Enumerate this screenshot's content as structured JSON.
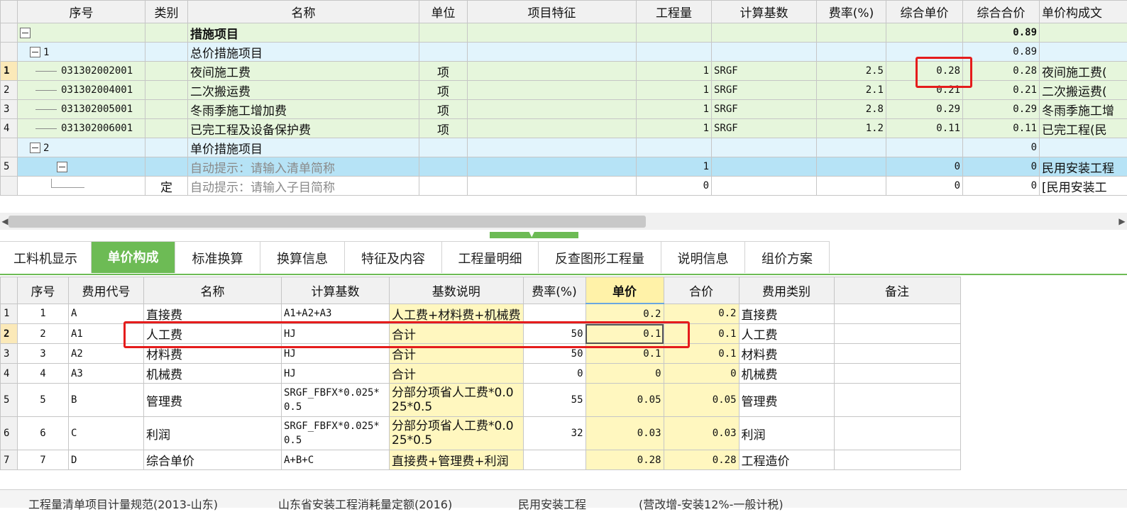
{
  "top_grid": {
    "headers": [
      "序号",
      "类别",
      "名称",
      "单位",
      "项目特征",
      "工程量",
      "计算基数",
      "费率(%)",
      "综合单价",
      "综合合价",
      "单价构成文"
    ],
    "group": {
      "name": "措施项目",
      "total": "0.89"
    },
    "subgroup1": {
      "code": "1",
      "name": "总价措施项目",
      "total": "0.89"
    },
    "rows": [
      {
        "num": "1",
        "code": "031302002001",
        "name": "夜间施工费",
        "unit": "项",
        "qty": "1",
        "base": "SRGF",
        "rate": "2.5",
        "price": "0.28",
        "total": "0.28",
        "comp": "夜间施工费("
      },
      {
        "num": "2",
        "code": "031302004001",
        "name": "二次搬运费",
        "unit": "项",
        "qty": "1",
        "base": "SRGF",
        "rate": "2.1",
        "price": "0.21",
        "total": "0.21",
        "comp": "二次搬运费("
      },
      {
        "num": "3",
        "code": "031302005001",
        "name": "冬雨季施工增加费",
        "unit": "项",
        "qty": "1",
        "base": "SRGF",
        "rate": "2.8",
        "price": "0.29",
        "total": "0.29",
        "comp": "冬雨季施工增"
      },
      {
        "num": "4",
        "code": "031302006001",
        "name": "已完工程及设备保护费",
        "unit": "项",
        "qty": "1",
        "base": "SRGF",
        "rate": "1.2",
        "price": "0.11",
        "total": "0.11",
        "comp": "已完工程(民"
      }
    ],
    "subgroup2": {
      "code": "2",
      "name": "单价措施项目",
      "total": "0"
    },
    "row5": {
      "num": "5",
      "name": "自动提示：请输入清单简称",
      "qty": "1",
      "price": "0",
      "total": "0",
      "comp": "民用安装工程"
    },
    "row6": {
      "type": "定",
      "name": "自动提示：请输入子目简称",
      "qty": "0",
      "price": "0",
      "total": "0",
      "comp": "[民用安装工"
    }
  },
  "tabs": [
    "工料机显示",
    "单价构成",
    "标准换算",
    "换算信息",
    "特征及内容",
    "工程量明细",
    "反查图形工程量",
    "说明信息",
    "组价方案"
  ],
  "bottom_grid": {
    "headers": [
      "序号",
      "费用代号",
      "名称",
      "计算基数",
      "基数说明",
      "费率(%)",
      "单价",
      "合价",
      "费用类别",
      "备注"
    ],
    "rows": [
      {
        "rn": "1",
        "seq": "1",
        "code": "A",
        "name": "直接费",
        "base": "A1+A2+A3",
        "desc": "人工费+材料费+机械费",
        "rate": "",
        "price": "0.2",
        "total": "0.2",
        "cat": "直接费"
      },
      {
        "rn": "2",
        "seq": "2",
        "code": "A1",
        "name": "人工费",
        "base": "HJ",
        "desc": "合计",
        "rate": "50",
        "price": "0.1",
        "total": "0.1",
        "cat": "人工费"
      },
      {
        "rn": "3",
        "seq": "3",
        "code": "A2",
        "name": "材料费",
        "base": "HJ",
        "desc": "合计",
        "rate": "50",
        "price": "0.1",
        "total": "0.1",
        "cat": "材料费"
      },
      {
        "rn": "4",
        "seq": "4",
        "code": "A3",
        "name": "机械费",
        "base": "HJ",
        "desc": "合计",
        "rate": "0",
        "price": "0",
        "total": "0",
        "cat": "机械费"
      },
      {
        "rn": "5",
        "seq": "5",
        "code": "B",
        "name": "管理费",
        "base": "SRGF_FBFX*0.025*0.5",
        "desc": "分部分项省人工费*0.025*0.5",
        "rate": "55",
        "price": "0.05",
        "total": "0.05",
        "cat": "管理费"
      },
      {
        "rn": "6",
        "seq": "6",
        "code": "C",
        "name": "利润",
        "base": "SRGF_FBFX*0.025*0.5",
        "desc": "分部分项省人工费*0.025*0.5",
        "rate": "32",
        "price": "0.03",
        "total": "0.03",
        "cat": "利润"
      },
      {
        "rn": "7",
        "seq": "7",
        "code": "D",
        "name": "综合单价",
        "base": "A+B+C",
        "desc": "直接费+管理费+利润",
        "rate": "",
        "price": "0.28",
        "total": "0.28",
        "cat": "工程造价"
      }
    ]
  },
  "status": {
    "item1": "工程量清单项目计量规范(2013-山东)",
    "item2": "山东省安装工程消耗量定额(2016)",
    "item3": "民用安装工程",
    "item4": "(营改增-安装12%-一般计税)"
  },
  "colors": {
    "accent": "#6dbb55",
    "highlight": "#e51c1c"
  }
}
